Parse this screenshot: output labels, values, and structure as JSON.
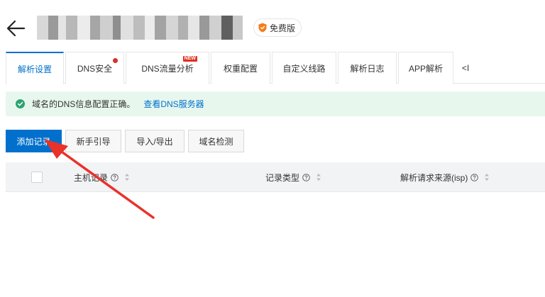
{
  "header": {
    "back_icon": "arrow-left-icon",
    "badge_label": "免费版",
    "badge_icon": "shield-icon"
  },
  "tabs": [
    {
      "label": "解析设置",
      "active": true
    },
    {
      "label": "DNS安全",
      "dot": true
    },
    {
      "label": "DNS流量分析",
      "new": "NEW"
    },
    {
      "label": "权重配置"
    },
    {
      "label": "自定义线路"
    },
    {
      "label": "解析日志"
    },
    {
      "label": "APP解析"
    }
  ],
  "tab_collapse": "<I",
  "alert": {
    "text": "域名的DNS信息配置正确。",
    "link": "查看DNS服务器"
  },
  "toolbar": {
    "add_record": "添加记录",
    "guide": "新手引导",
    "import_export": "导入/导出",
    "domain_check": "域名检测"
  },
  "table": {
    "columns": [
      "主机记录",
      "记录类型",
      "解析请求来源(isp)"
    ]
  },
  "colors": {
    "primary": "#0070cc",
    "alert_bg": "#e8f7ee",
    "success": "#2ba471",
    "badge_orange": "#f57c1a",
    "annotation_red": "#e8322a"
  }
}
